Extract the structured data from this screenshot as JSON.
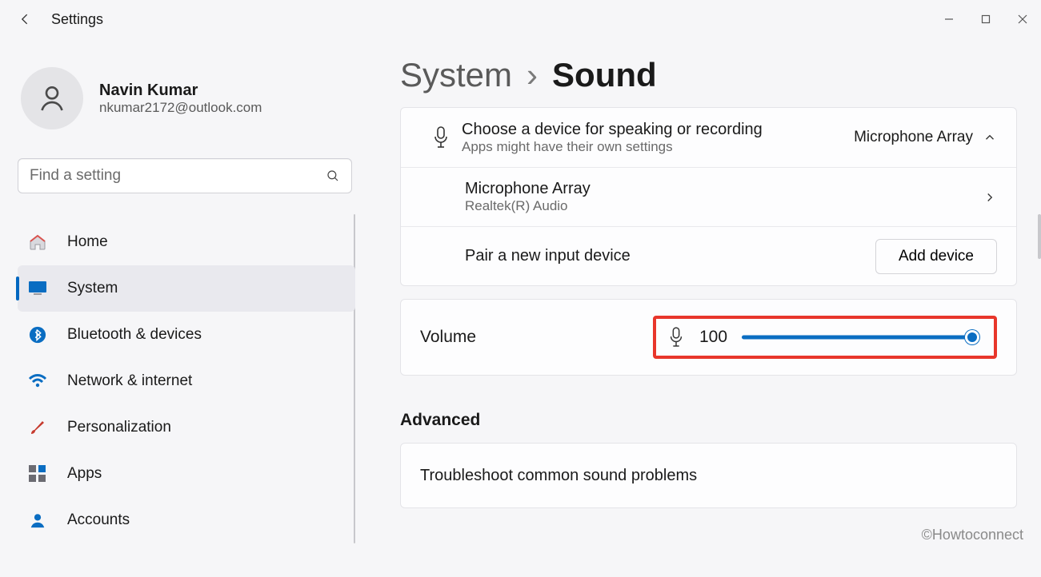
{
  "titlebar": {
    "app_title": "Settings"
  },
  "profile": {
    "name": "Navin Kumar",
    "email": "nkumar2172@outlook.com"
  },
  "search": {
    "placeholder": "Find a setting"
  },
  "nav": {
    "items": [
      {
        "label": "Home"
      },
      {
        "label": "System"
      },
      {
        "label": "Bluetooth & devices"
      },
      {
        "label": "Network & internet"
      },
      {
        "label": "Personalization"
      },
      {
        "label": "Apps"
      },
      {
        "label": "Accounts"
      }
    ]
  },
  "breadcrumb": {
    "parent": "System",
    "sep": "›",
    "current": "Sound"
  },
  "sound": {
    "input_header": {
      "title": "Choose a device for speaking or recording",
      "sub": "Apps might have their own settings",
      "value": "Microphone Array"
    },
    "mic_device": {
      "title": "Microphone Array",
      "sub": "Realtek(R) Audio"
    },
    "pair": {
      "title": "Pair a new input device",
      "button": "Add device"
    },
    "volume": {
      "label": "Volume",
      "value": "100"
    },
    "advanced_header": "Advanced",
    "troubleshoot": {
      "title": "Troubleshoot common sound problems"
    }
  },
  "watermark": "©Howtoconnect"
}
